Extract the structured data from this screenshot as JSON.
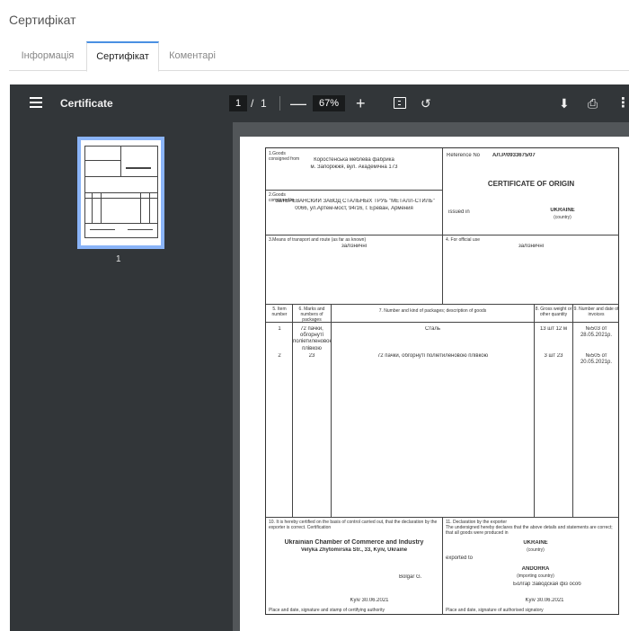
{
  "page": {
    "title": "Сертифікат"
  },
  "tabs": [
    {
      "label": "Інформація",
      "active": false
    },
    {
      "label": "Сертифікат",
      "active": true
    },
    {
      "label": "Коментарі",
      "active": false
    }
  ],
  "viewer": {
    "doc_title": "Certificate",
    "page_current": "1",
    "page_separator": "/",
    "page_total": "1",
    "zoom": "67%",
    "thumbnail_label": "1",
    "icons": {
      "menu": "menu-icon",
      "fit": "fit-page-icon",
      "rotate": "rotate-icon",
      "download": "download-icon",
      "print": "print-icon",
      "more": "more-vert-icon"
    }
  },
  "certificate": {
    "f1_label": "1.Goods consigned from",
    "f1_line1": "Коростенська меблева фабрика",
    "f1_line2": "м. Запоріжжя, вул. Академічна 173",
    "ref_label": "Reference No",
    "ref_value": "АЛ.Р/0933675/07",
    "heading": "CERTIFICATE OF ORIGIN",
    "country_label": "issued in",
    "country_value": "UKRAINE",
    "country_sub": "(country)",
    "f2_label": "2.Goods consigned to",
    "f2_line1": "\"ЗАТЕРЕВАНСКИЙ ЗАВОД СТАЛЬНЫХ ТРУБ \"МЕТАЛЛ-СТИЛЬ\"",
    "f2_line2": "0066, ул.Артем-мост, 94/16, г. Ереван, Армения",
    "f3_label": "3.Means of transport and route (as far as known)",
    "f3_value": "залізничні",
    "f4_label": "4. For official use",
    "f4_value": "залізничні",
    "col5": "5. Item number",
    "col6": "6. Marks and numbers of packages",
    "col7": "7. Number and kind of packages; description of goods",
    "col8": "8. Gross weight or other quantity",
    "col9": "9. Number and date of invoices",
    "row1_no": "1",
    "row1_marks": "72 пачки, обгорнуті поліетиленовою плівкою",
    "row1_desc": "Сталь",
    "row1_qty": "13 шт 12 м",
    "row1_inv": "№503 от 28.05.2021р.",
    "row2_no": "2",
    "row2_marks": "23",
    "row2_desc": "72 пачки, обгорнуті поліетиленовою плівкою",
    "row2_qty": "3 шт 23",
    "row2_inv": "№505 от 20.05.2021р.",
    "f10_label": "10. It is hereby certified on the basis of control carried out, that the declaration by the exporter is correct. Certification",
    "chamber_line1": "Ukrainian Chamber of Commerce and Industry",
    "chamber_line2": "Velyka Zhytomirska Str., 33, Kyiv, Ukraine",
    "signer": "Bolgar G.",
    "f10_place": "Kyiv  30.06.2021",
    "f10_footer": "Place and date, signature and stamp of certifying authority",
    "f11_label": "11. Declaration by the exporter",
    "f11_text": "The undersigned hereby declares that the above details and statements are correct; that all goods were produced in",
    "f11_country": "UKRAINE",
    "f11_country_sub": "(country)",
    "f11_exported": "exported to",
    "f11_import": "ANDORRA",
    "f11_import_sub": "(importing country)",
    "f11_signer": "Болгар Заводская фіз особ",
    "f11_place": "Kyiv  30.06.2021",
    "f11_footer": "Place and date, signature of authorised signatory"
  }
}
